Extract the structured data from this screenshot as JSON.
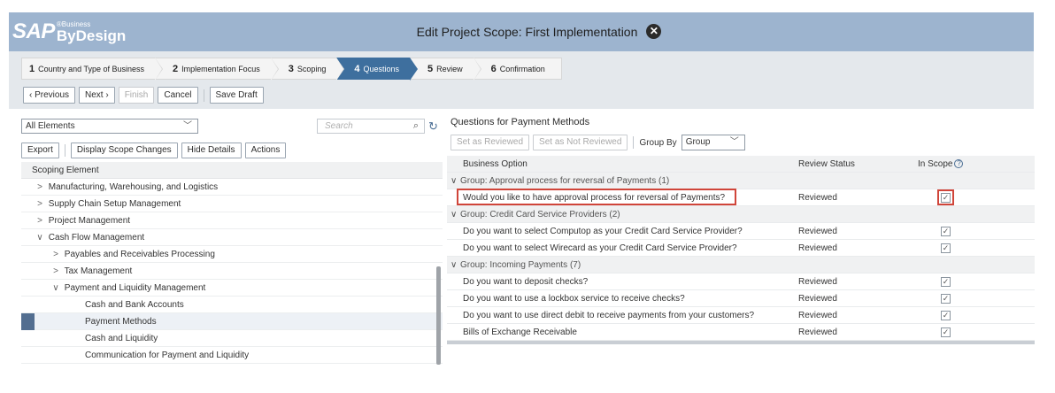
{
  "header": {
    "logo_sap": "SAP",
    "logo_business": "®Business",
    "logo_bydesign": "ByDesign",
    "title": "Edit Project Scope: First Implementation"
  },
  "wizard": {
    "steps": [
      {
        "num": "1",
        "label": "Country and Type of Business"
      },
      {
        "num": "2",
        "label": "Implementation Focus"
      },
      {
        "num": "3",
        "label": "Scoping"
      },
      {
        "num": "4",
        "label": "Questions"
      },
      {
        "num": "5",
        "label": "Review"
      },
      {
        "num": "6",
        "label": "Confirmation"
      }
    ],
    "active_step": "4",
    "buttons": {
      "previous": "‹ Previous",
      "next": "Next ›",
      "finish": "Finish",
      "cancel": "Cancel",
      "save_draft": "Save Draft"
    }
  },
  "left": {
    "filter_value": "All Elements",
    "search_placeholder": "Search",
    "toolbar": {
      "export": "Export",
      "display_scope_changes": "Display Scope Changes",
      "hide_details": "Hide Details",
      "actions": "Actions"
    },
    "tree_header": "Scoping Element",
    "tree": [
      {
        "label": "Manufacturing, Warehousing, and Logistics",
        "arrow": ">"
      },
      {
        "label": "Supply Chain Setup Management",
        "arrow": ">"
      },
      {
        "label": "Project Management",
        "arrow": ">"
      },
      {
        "label": "Cash Flow Management",
        "arrow": "∨"
      },
      {
        "label": "Payables and Receivables Processing",
        "arrow": ">"
      },
      {
        "label": "Tax Management",
        "arrow": ">"
      },
      {
        "label": "Payment and Liquidity Management",
        "arrow": "∨"
      },
      {
        "label": "Cash and Bank Accounts",
        "arrow": ""
      },
      {
        "label": "Payment Methods",
        "arrow": ""
      },
      {
        "label": "Cash and Liquidity",
        "arrow": ""
      },
      {
        "label": "Communication for Payment and Liquidity",
        "arrow": ""
      }
    ]
  },
  "right": {
    "title": "Questions for Payment Methods",
    "toolbar": {
      "set_reviewed": "Set as Reviewed",
      "set_not_reviewed": "Set as Not Reviewed",
      "group_by_label": "Group By",
      "group_by_value": "Group"
    },
    "columns": {
      "business_option": "Business Option",
      "review_status": "Review Status",
      "in_scope": "In Scope"
    },
    "groups": [
      {
        "label": "Group: Approval process for reversal of Payments (1)",
        "rows": [
          {
            "question": "Would you like to have approval process for reversal of Payments?",
            "status": "Reviewed",
            "checked": "✓"
          }
        ]
      },
      {
        "label": "Group: Credit Card Service Providers (2)",
        "rows": [
          {
            "question": "Do you want to select Computop as your Credit Card Service Provider?",
            "status": "Reviewed",
            "checked": "✓"
          },
          {
            "question": "Do you want to select Wirecard as your Credit Card Service Provider?",
            "status": "Reviewed",
            "checked": "✓"
          }
        ]
      },
      {
        "label": "Group: Incoming Payments (7)",
        "rows": [
          {
            "question": "Do you want to deposit checks?",
            "status": "Reviewed",
            "checked": "✓"
          },
          {
            "question": "Do you want to use a lockbox service to receive checks?",
            "status": "Reviewed",
            "checked": "✓"
          },
          {
            "question": "Do you want to use direct debit to receive payments from your customers?",
            "status": "Reviewed",
            "checked": "✓"
          },
          {
            "question": "Bills of Exchange Receivable",
            "status": "Reviewed",
            "checked": "✓"
          }
        ]
      }
    ]
  },
  "colors": {
    "header_bg": "#9db4cf",
    "active_step": "#3e6f9e",
    "highlight_border": "#d0453a"
  }
}
